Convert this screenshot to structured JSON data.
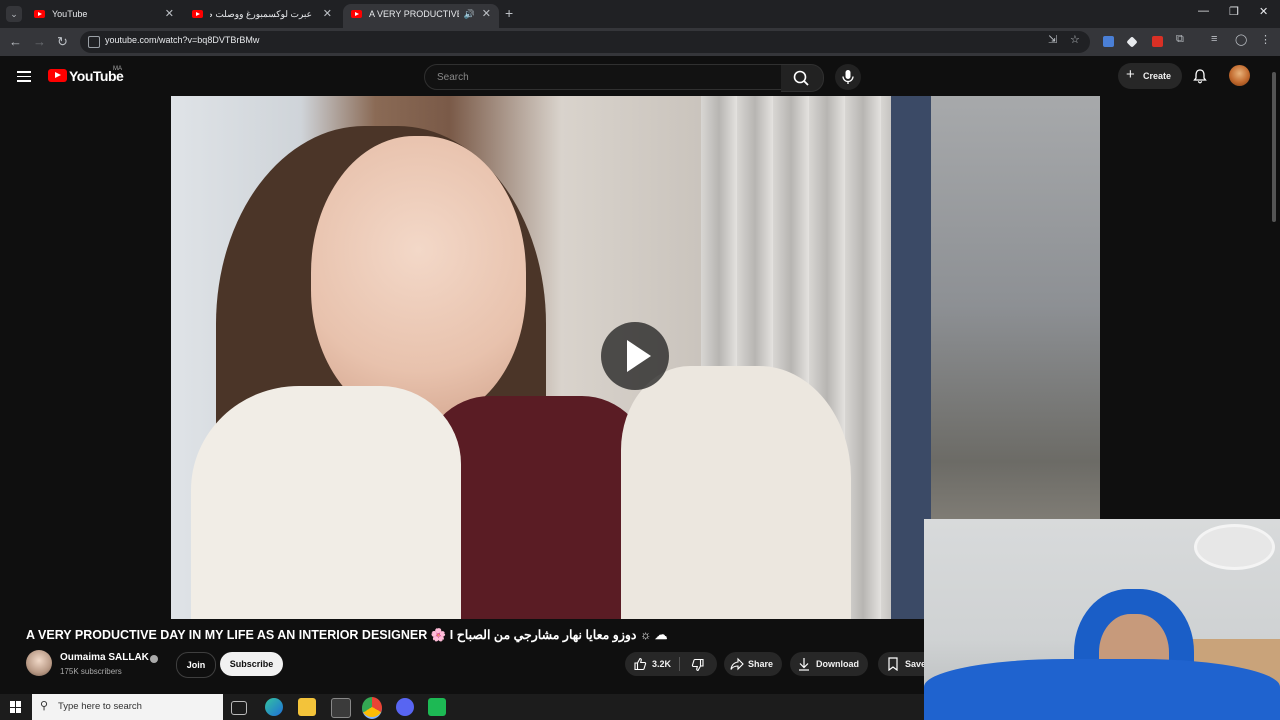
{
  "browser": {
    "tabs": [
      {
        "label": "YouTube",
        "active": false
      },
      {
        "label": "عبرت لوكسمبورغ ووصلت ضواحي",
        "active": false
      },
      {
        "label": "A VERY PRODUCTIVE DAY I",
        "active": true
      }
    ],
    "url": "youtube.com/watch?v=bq8DVTBrBMw"
  },
  "youtube": {
    "logo_text": "YouTube",
    "country_code": "MA",
    "search_placeholder": "Search",
    "create_label": "Create"
  },
  "video": {
    "title": "A VERY PRODUCTIVE DAY IN MY LIFE AS AN INTERIOR DESIGNER 🌸 I دوزو معايا نهار مشارجي من الصباح ☼ ☁",
    "channel_name": "Oumaima SALLAK",
    "subscribers": "175K subscribers",
    "join_label": "Join",
    "subscribe_label": "Subscribe",
    "likes": "3.2K",
    "share_label": "Share",
    "download_label": "Download",
    "save_label": "Save"
  },
  "taskbar": {
    "search_placeholder": "Type here to search"
  },
  "colors": {
    "youtube_red": "#ff0000",
    "background": "#0f0f0f",
    "tabstrip": "#202124"
  }
}
